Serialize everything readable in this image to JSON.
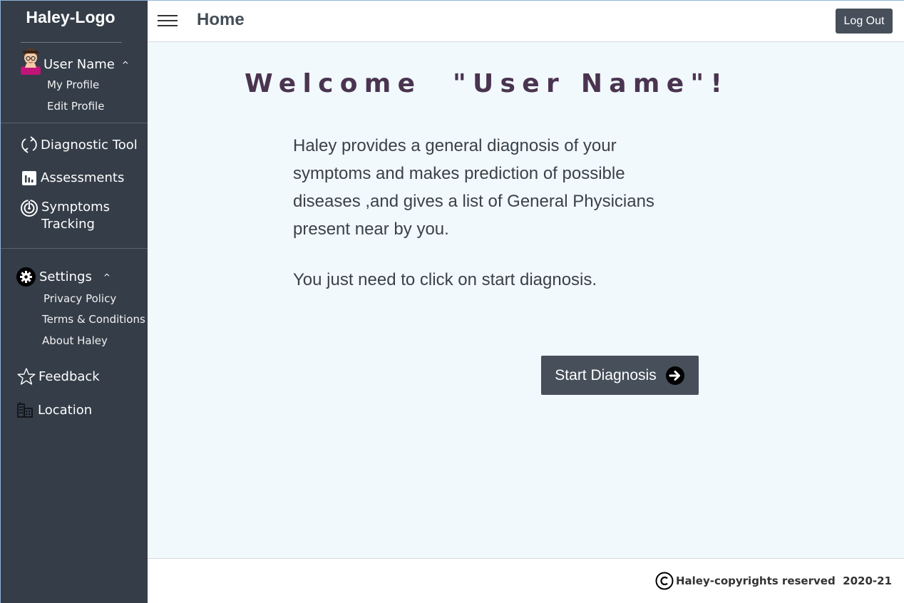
{
  "sidebar": {
    "logo": "Haley-Logo",
    "user": {
      "name": "User Name",
      "caret": "^",
      "items": [
        {
          "label": "My Profile"
        },
        {
          "label": "Edit Profile"
        }
      ]
    },
    "nav": [
      {
        "label": "Diagnostic Tool",
        "icon": "refresh-icon"
      },
      {
        "label": "Assessments",
        "icon": "bar-chart-icon"
      },
      {
        "label": "Symptoms",
        "label2": "Tracking",
        "icon": "target-icon"
      }
    ],
    "settings": {
      "label": "Settings",
      "caret": "^",
      "icon": "gear-icon",
      "items": [
        {
          "label": "Privacy Policy"
        },
        {
          "label": "Terms & Conditions"
        },
        {
          "label": "About Haley"
        }
      ]
    },
    "feedback": {
      "label": "Feedback",
      "icon": "star-icon"
    },
    "location": {
      "label": "Location",
      "icon": "building-icon"
    }
  },
  "header": {
    "title": "Home",
    "logout_label": "Log Out"
  },
  "main": {
    "welcome": "Welcome  \"User Name\"!",
    "description": "Haley provides a general diagnosis of your symptoms and makes prediction of possible diseases ,and gives a list of General Physicians present near by you.",
    "instruction": "You just need to click on start diagnosis.",
    "start_label": "Start Diagnosis"
  },
  "footer": {
    "copyright": "Haley-copyrights reserved  2020-21"
  },
  "colors": {
    "sidebar_bg": "#343d48",
    "main_bg": "#f1f9fd",
    "button_bg": "#464f5a",
    "welcome_text": "#4a3450"
  }
}
